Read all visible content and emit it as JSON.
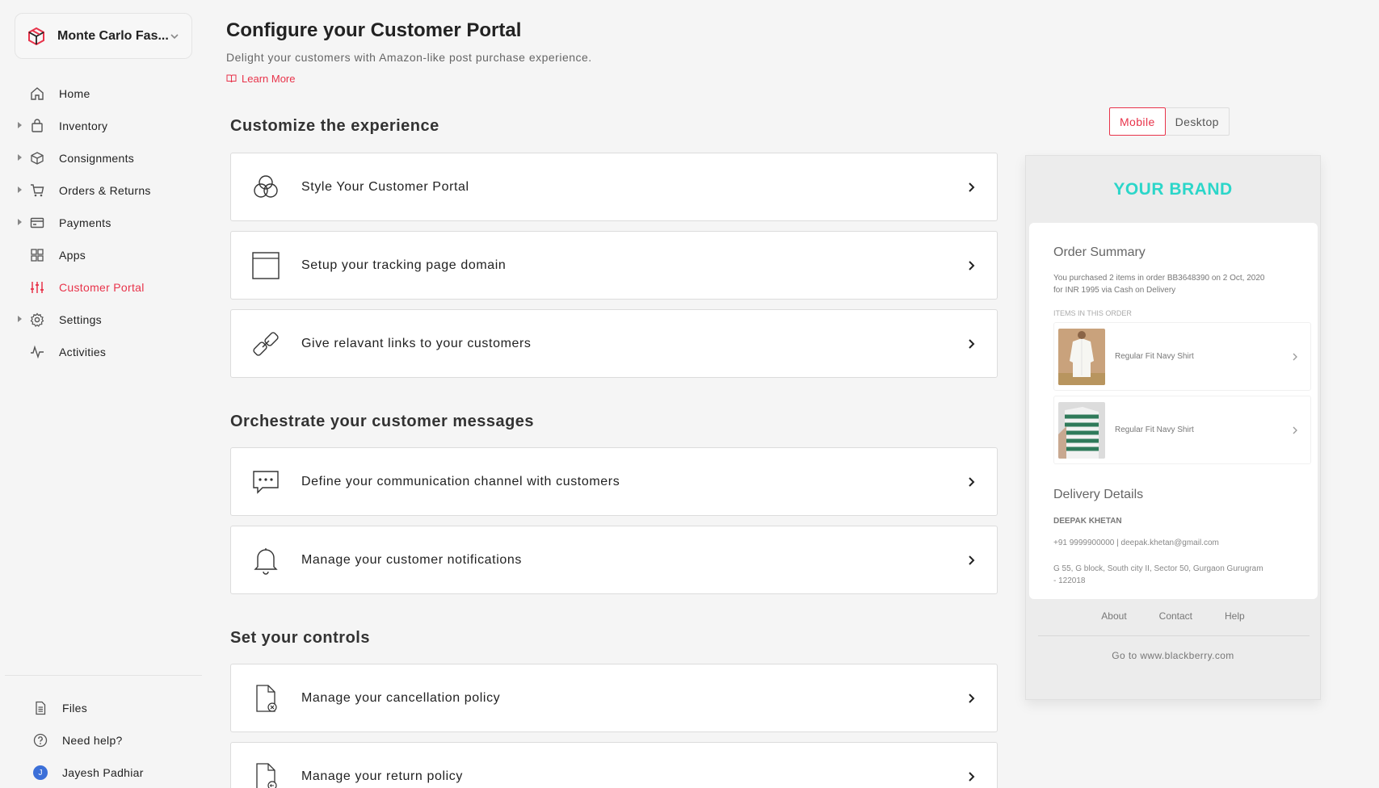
{
  "org": {
    "name": "Monte Carlo Fas..."
  },
  "nav": [
    {
      "label": "Home",
      "icon": "home-icon",
      "expandable": false
    },
    {
      "label": "Inventory",
      "icon": "bag-icon",
      "expandable": true
    },
    {
      "label": "Consignments",
      "icon": "box-icon",
      "expandable": true
    },
    {
      "label": "Orders & Returns",
      "icon": "cart-icon",
      "expandable": true
    },
    {
      "label": "Payments",
      "icon": "card-icon",
      "expandable": true
    },
    {
      "label": "Apps",
      "icon": "grid-icon",
      "expandable": false
    },
    {
      "label": "Customer Portal",
      "icon": "sliders-icon",
      "expandable": false,
      "active": true
    },
    {
      "label": "Settings",
      "icon": "gear-icon",
      "expandable": true
    },
    {
      "label": "Activities",
      "icon": "activity-icon",
      "expandable": false
    }
  ],
  "bottom_nav": [
    {
      "label": "Files",
      "icon": "file-icon"
    },
    {
      "label": "Need help?",
      "icon": "help-icon"
    },
    {
      "label": "Jayesh Padhiar",
      "icon": "avatar",
      "initial": "J"
    }
  ],
  "header": {
    "title": "Configure your Customer Portal",
    "subtitle": "Delight your customers with Amazon-like post purchase experience.",
    "learn_more": "Learn More"
  },
  "sections": [
    {
      "title": "Customize the experience",
      "cards": [
        {
          "label": "Style Your Customer Portal",
          "icon": "circles-icon"
        },
        {
          "label": "Setup your tracking page domain",
          "icon": "browser-icon"
        },
        {
          "label": "Give relavant links to your customers",
          "icon": "link-icon"
        }
      ]
    },
    {
      "title": "Orchestrate your customer messages",
      "cards": [
        {
          "label": "Define your communication channel with customers",
          "icon": "chat-icon"
        },
        {
          "label": "Manage your customer notifications",
          "icon": "bell-icon"
        }
      ]
    },
    {
      "title": "Set your controls",
      "cards": [
        {
          "label": "Manage your cancellation policy",
          "icon": "doc-cancel-icon"
        },
        {
          "label": "Manage your return policy",
          "icon": "doc-return-icon"
        }
      ]
    }
  ],
  "preview": {
    "toggle": {
      "mobile": "Mobile",
      "desktop": "Desktop",
      "selected": "Mobile"
    },
    "brand": "YOUR BRAND",
    "order_summary_title": "Order Summary",
    "order_summary_text": "You purchased 2 items in order BB3648390 on 2 Oct, 2020 for INR 1995 via Cash on Delivery",
    "items_heading": "ITEMS IN THIS ORDER",
    "items": [
      {
        "name": "Regular Fit Navy Shirt"
      },
      {
        "name": "Regular Fit Navy Shirt"
      }
    ],
    "delivery_title": "Delivery Details",
    "delivery_name": "DEEPAK KHETAN",
    "delivery_contact": "+91 9999900000 | deepak.khetan@gmail.com",
    "delivery_address": "G 55, G block, South city II, Sector 50, Gurgaon Gurugram - 122018",
    "footer_links": [
      "About",
      "Contact",
      "Help"
    ],
    "goto": "Go to www.blackberry.com"
  },
  "colors": {
    "accent": "#e8334a",
    "brand": "#2bd6c9",
    "avatar": "#3b6fd8"
  }
}
